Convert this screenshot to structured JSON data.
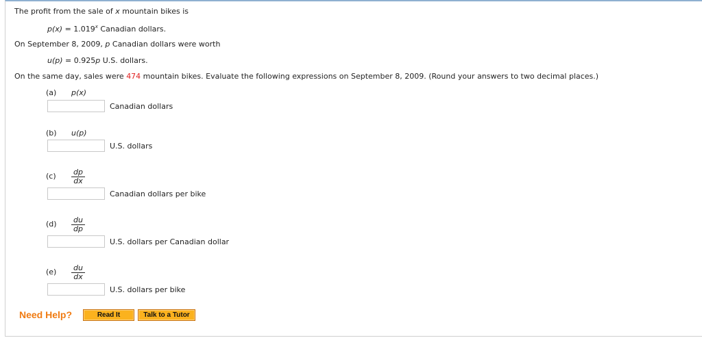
{
  "intro": {
    "line1_a": "The profit from the sale of ",
    "line1_var": "x",
    "line1_b": " mountain bikes is",
    "p_fn": "p(x)",
    "p_eq": " = 1.019",
    "p_exp": "x",
    "p_unit": " Canadian dollars.",
    "line3_a": "On September 8, 2009, ",
    "line3_var": "p",
    "line3_b": " Canadian dollars were worth",
    "u_fn": "u(p)",
    "u_eq": " = 0.925",
    "u_var": "p",
    "u_unit": " U.S. dollars.",
    "line5_a": "On the same day, sales were ",
    "line5_num": "474",
    "line5_b": " mountain bikes. Evaluate the following expressions on September 8, 2009. (Round your answers to two decimal places.)"
  },
  "parts": [
    {
      "label": "(a)",
      "expr": "p(x)",
      "value": "",
      "unit": "Canadian dollars"
    },
    {
      "label": "(b)",
      "expr": "u(p)",
      "value": "",
      "unit": "U.S. dollars"
    },
    {
      "label": "(c)",
      "num": "dp",
      "den": "dx",
      "value": "",
      "unit": "Canadian dollars per bike"
    },
    {
      "label": "(d)",
      "num": "du",
      "den": "dp",
      "value": "",
      "unit": "U.S. dollars per Canadian dollar"
    },
    {
      "label": "(e)",
      "num": "du",
      "den": "dx",
      "value": "",
      "unit": "U.S. dollars per bike"
    }
  ],
  "help": {
    "label": "Need Help?",
    "read_it": "Read It",
    "tutor": "Talk to a Tutor"
  },
  "colors": {
    "highlight": "#e02020",
    "help": "#f07b12",
    "button": "#fbb21e"
  }
}
